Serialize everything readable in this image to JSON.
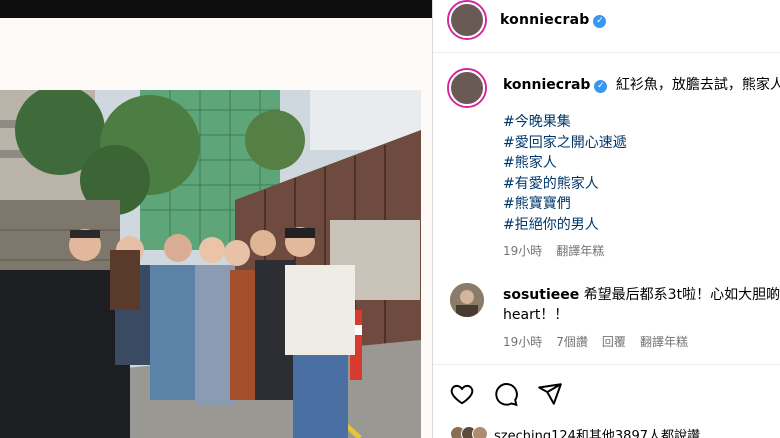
{
  "post_header": {
    "username": "konniecrab",
    "verified": true
  },
  "caption": {
    "username": "konniecrab",
    "text": "紅衫魚，放膽去試，熊家人",
    "hashtags": [
      "#今晚果集",
      "#愛回家之開心速遞",
      "#熊家人",
      "#有愛的熊家人",
      "#熊寶寶們",
      "#拒絕你的男人"
    ],
    "time": "19小時",
    "translate": "翻譯年糕"
  },
  "comment": {
    "username": "sosutieee",
    "text": "希望最后都系3t啦！心如大胆啲",
    "text_line2": "heart！！",
    "time": "19小時",
    "likes": "7個讚",
    "reply": "回覆",
    "translate": "翻譯年糕"
  },
  "actions": {
    "like": "heart-icon",
    "comment": "comment-icon",
    "share": "share-icon"
  },
  "likes_line": "szeching124和其他3897人都說讚",
  "colors": {
    "link": "#00376b",
    "verified": "#3897f0",
    "meta": "#737373"
  }
}
